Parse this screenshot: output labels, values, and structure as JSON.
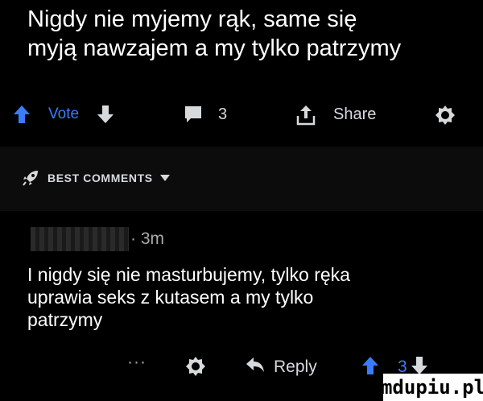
{
  "post": {
    "title_lines": [
      "Nigdy nie myjemy rąk, same się",
      "myją nawzajem a my tylko patrzymy"
    ]
  },
  "actions": {
    "vote_label": "Vote",
    "comment_count": "3",
    "share_label": "Share"
  },
  "comments_section": {
    "sort_label": "BEST COMMENTS"
  },
  "comment": {
    "meta": "· 3m",
    "body_lines": [
      "I nigdy się nie masturbujemy, tylko ręka",
      "uprawia seks z kutasem a my tylko",
      "patrzymy"
    ],
    "more_label": "···",
    "reply_label": "Reply",
    "score": "3"
  },
  "watermark": {
    "text": "mdupiu.pl"
  },
  "colors": {
    "accent": "#3b7cff",
    "text": "#ffffff",
    "muted": "#a8aaab",
    "background": "#000000"
  },
  "icons": [
    "arrow-up-icon",
    "arrow-down-icon",
    "comment-icon",
    "share-icon",
    "award-icon",
    "rocket-icon",
    "caret-down-icon",
    "reply-icon"
  ]
}
